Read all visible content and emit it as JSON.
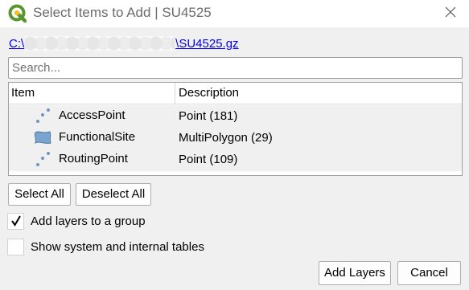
{
  "window": {
    "title": "Select Items to Add | SU4525",
    "app_icon": "qgis-logo-icon",
    "close_icon": "close-icon"
  },
  "path": {
    "prefix": "C:\\",
    "suffix": "\\SU4525.gz"
  },
  "search": {
    "placeholder": "Search...",
    "value": ""
  },
  "tree": {
    "columns": [
      "Item",
      "Description"
    ],
    "rows": [
      {
        "name": "AccessPoint",
        "description": "Point (181)",
        "icon": "point-layer-icon"
      },
      {
        "name": "FunctionalSite",
        "description": "MultiPolygon (29)",
        "icon": "polygon-layer-icon"
      },
      {
        "name": "RoutingPoint",
        "description": "Point (109)",
        "icon": "point-layer-icon"
      }
    ]
  },
  "selection_buttons": {
    "select_all": "Select All",
    "deselect_all": "Deselect All"
  },
  "options": {
    "add_to_group": {
      "label": "Add layers to a group",
      "checked": true
    },
    "show_system_tables": {
      "label": "Show system and internal tables",
      "checked": false
    }
  },
  "dialog_buttons": {
    "add_layers": "Add Layers",
    "cancel": "Cancel"
  },
  "colors": {
    "link": "#0000ee",
    "layer_icon": "#6b95c2",
    "qgis_green": "#589632",
    "qgis_yellow": "#f0c12b"
  }
}
